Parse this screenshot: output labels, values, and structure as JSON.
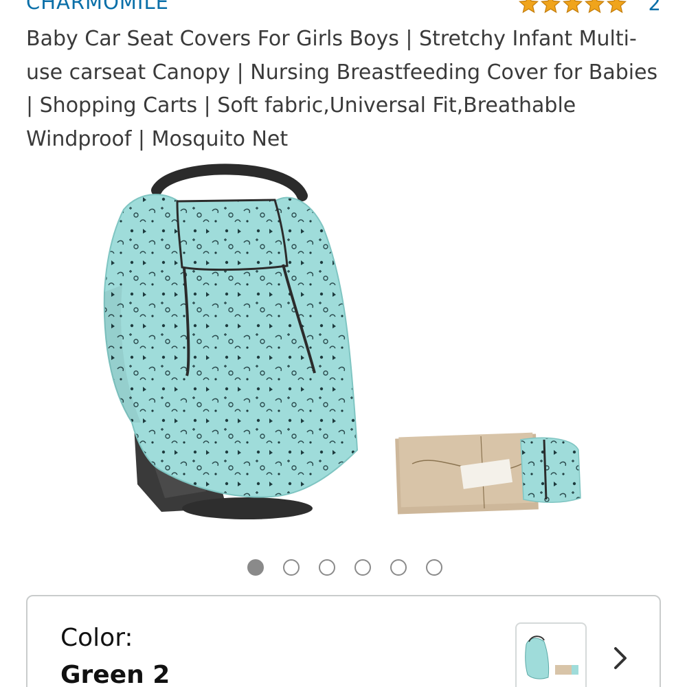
{
  "product": {
    "brand": "CHARMOMILE",
    "rating": 5,
    "rating_count": "2",
    "title": "Baby Car Seat Covers For Girls Boys | Stretchy Infant Multi-use carseat Canopy | Nursing Breastfeeding Cover for Babies | Shopping Carts | Soft fabric,Universal Fit,Breathable Windproof | Mosquito Net"
  },
  "gallery": {
    "image_count": 6,
    "active_index": 0
  },
  "variation": {
    "label": "Color:",
    "value": "Green 2"
  },
  "colors": {
    "brand_link": "#0a6fa8",
    "star": "#f0a41c",
    "fabric": "#9fdcda",
    "border": "#c9cccc"
  },
  "icons": {
    "rating": "star-icon",
    "next": "chevron-right-icon"
  }
}
